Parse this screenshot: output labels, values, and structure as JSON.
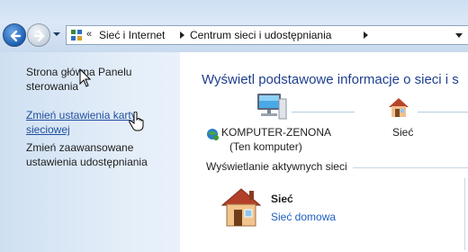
{
  "address_bar": {
    "overflow": "«",
    "crumbs": [
      "Sieć i Internet",
      "Centrum sieci i udostępniania"
    ]
  },
  "left_pane": {
    "items": [
      {
        "label_line1": "Strona główna Panelu",
        "label_line2": "sterowania"
      },
      {
        "label_line1": "Zmień ustawienia karty",
        "label_line2": "sieciowej"
      },
      {
        "label_line1": "Zmień zaawansowane",
        "label_line2": "ustawienia udostępniania"
      }
    ]
  },
  "main": {
    "title": "Wyświetl podstawowe informacje o sieci i s",
    "computer": {
      "name": "KOMPUTER-ZENONA",
      "subtitle": "(Ten komputer)"
    },
    "network_node": {
      "name": "Sieć"
    },
    "active_networks_header": "Wyświetlanie aktywnych sieci",
    "active_network": {
      "name": "Sieć",
      "type": "Sieć domowa"
    }
  },
  "colors": {
    "title_blue": "#1f3f8e",
    "link_blue": "#1f5fbf"
  }
}
